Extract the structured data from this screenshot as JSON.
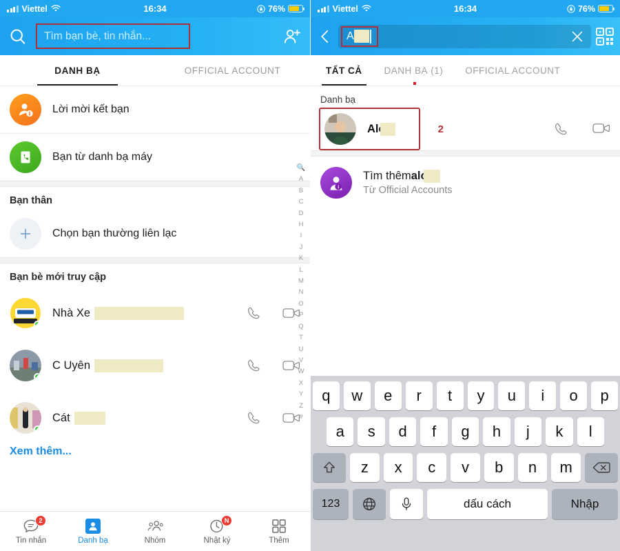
{
  "status_bar": {
    "carrier": "Viettel",
    "time": "16:34",
    "battery_percent": "76%",
    "wifi_icon": "wifi-icon",
    "signal_icon": "signal-bars-icon",
    "lock_icon": "rotation-lock-icon",
    "battery_icon": "battery-icon",
    "battery_color": "#ffcc00",
    "background_color": "#20a7f0"
  },
  "left_screen": {
    "search": {
      "placeholder": "Tìm bạn bè, tin nhắn...",
      "search_icon": "search-icon",
      "add_friend_icon": "add-friend-icon",
      "highlight_color": "#b0303a"
    },
    "tabs": [
      {
        "label": "DANH BẠ",
        "active": true
      },
      {
        "label": "OFFICIAL ACCOUNT",
        "active": false
      }
    ],
    "menu_items": [
      {
        "label": "Lời mời kết bạn",
        "icon": "friend-request-icon",
        "color": "#f4711d"
      },
      {
        "label": "Bạn từ danh bạ máy",
        "icon": "phonebook-icon",
        "color": "#3ba81e"
      }
    ],
    "favorites": {
      "title": "Bạn thân",
      "add_label": "Chọn bạn thường liên lạc",
      "add_icon": "plus-icon"
    },
    "recent": {
      "title": "Bạn bè mới truy cập",
      "contacts": [
        {
          "name": "Nhà Xe",
          "redacted_width": 130,
          "avatar": "bus-company-logo",
          "online": true,
          "call_icon": "phone-icon",
          "video_icon": "video-camera-icon"
        },
        {
          "name": "C Uyên",
          "redacted_width": 100,
          "avatar": "photo-avatar",
          "online": true,
          "call_icon": "phone-icon",
          "video_icon": "video-camera-icon"
        },
        {
          "name": "Cát",
          "redacted_width": 45,
          "avatar": "photo-avatar",
          "online": true,
          "call_icon": "phone-icon",
          "video_icon": "video-camera-icon"
        }
      ],
      "see_more": "Xem thêm..."
    },
    "alpha_index": [
      "A",
      "B",
      "C",
      "D",
      "H",
      "I",
      "J",
      "K",
      "L",
      "M",
      "N",
      "O",
      "P",
      "Q",
      "T",
      "U",
      "V",
      "W",
      "X",
      "Y",
      "Z",
      "#"
    ],
    "alpha_index_search_icon": "search-icon",
    "tabbar": [
      {
        "label": "Tin nhắn",
        "icon": "message-icon",
        "badge": "2",
        "active": false
      },
      {
        "label": "Danh bạ",
        "icon": "contacts-icon",
        "badge": "",
        "active": true
      },
      {
        "label": "Nhóm",
        "icon": "group-icon",
        "badge": "",
        "active": false
      },
      {
        "label": "Nhật ký",
        "icon": "clock-diary-icon",
        "badge": "N",
        "active": false
      },
      {
        "label": "Thêm",
        "icon": "grid-more-icon",
        "badge": "",
        "active": false
      }
    ]
  },
  "right_screen": {
    "search": {
      "back_icon": "back-chevron-icon",
      "query": "Alo",
      "clear_icon": "close-x-icon",
      "qr_icon": "qr-code-icon",
      "highlight_color": "#b0303a"
    },
    "tabs": [
      {
        "label": "TẤT CẢ",
        "active": true,
        "dot": false
      },
      {
        "label": "DANH BẠ (1)",
        "active": false,
        "dot": true
      },
      {
        "label": "OFFICIAL ACCOUNT",
        "active": false,
        "dot": false
      }
    ],
    "results_section_title": "Danh bạ",
    "result": {
      "name": "Alo",
      "redacted_width": 22,
      "avatar": "photo-avatar",
      "annotation_number": "2",
      "call_icon": "phone-icon",
      "video_icon": "video-camera-icon"
    },
    "official_account": {
      "title_prefix": "Tìm thêm ",
      "title_query": "alo",
      "redacted_width": 24,
      "subtitle": "Từ Official Accounts",
      "icon": "official-account-icon",
      "color": "#7b1fb0"
    },
    "keyboard": {
      "row1": [
        "q",
        "w",
        "e",
        "r",
        "t",
        "y",
        "u",
        "i",
        "o",
        "p"
      ],
      "row2": [
        "a",
        "s",
        "d",
        "f",
        "g",
        "h",
        "j",
        "k",
        "l"
      ],
      "row3": [
        "z",
        "x",
        "c",
        "v",
        "b",
        "n",
        "m"
      ],
      "shift_icon": "shift-arrow-icon",
      "backspace_icon": "backspace-icon",
      "numbers_key": "123",
      "globe_icon": "globe-icon",
      "mic_icon": "microphone-icon",
      "space_key": "dấu cách",
      "enter_key": "Nhập"
    }
  }
}
